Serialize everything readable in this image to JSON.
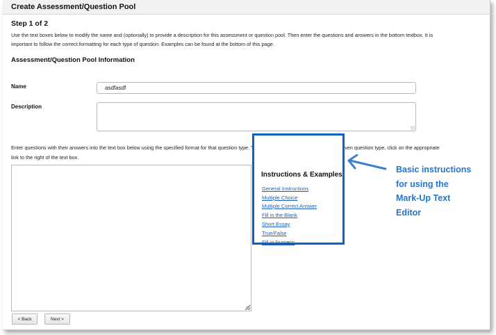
{
  "page": {
    "title": "Create Assessment/Question Pool",
    "step": "Step 1 of 2",
    "intro_line1": "Use the text boxes below to modify the name and (optionally) to provide a description for this assessment or question pool. Then enter the questions and answers in the bottom textbox. It is",
    "intro_line2": "important to follow the correct formatting for each type of question. Examples can be found at the bottom of this page."
  },
  "info_section": {
    "title": "Assessment/Question Pool Information",
    "name_label": "Name",
    "name_value": "asdfasdf",
    "description_label": "Description",
    "description_value": ""
  },
  "questions": {
    "instructions_line1": "Enter questions with their answers into the text box below using the specified format for that question type. To view instructions and examples for a given question type, click on the appropriate",
    "instructions_line2": "link to the right of the text box.",
    "textarea_value": ""
  },
  "examples_panel": {
    "title": "Instructions & Examples",
    "links": [
      "General Instructions",
      "Multiple Choice",
      "Multiple Correct Answer",
      "Fill in the Blank",
      "Short Essay",
      "True/False",
      "Fill in Numeric"
    ]
  },
  "nav": {
    "back_label": "< Back",
    "next_label": "Next >"
  },
  "callout": {
    "line1": "Basic instructions",
    "line2": "for using the",
    "line3": "Mark-Up Text",
    "line4": "Editor"
  },
  "colors": {
    "highlight_border": "#0a64bf",
    "callout_text": "#2276cf",
    "link": "#1b5fb8"
  }
}
